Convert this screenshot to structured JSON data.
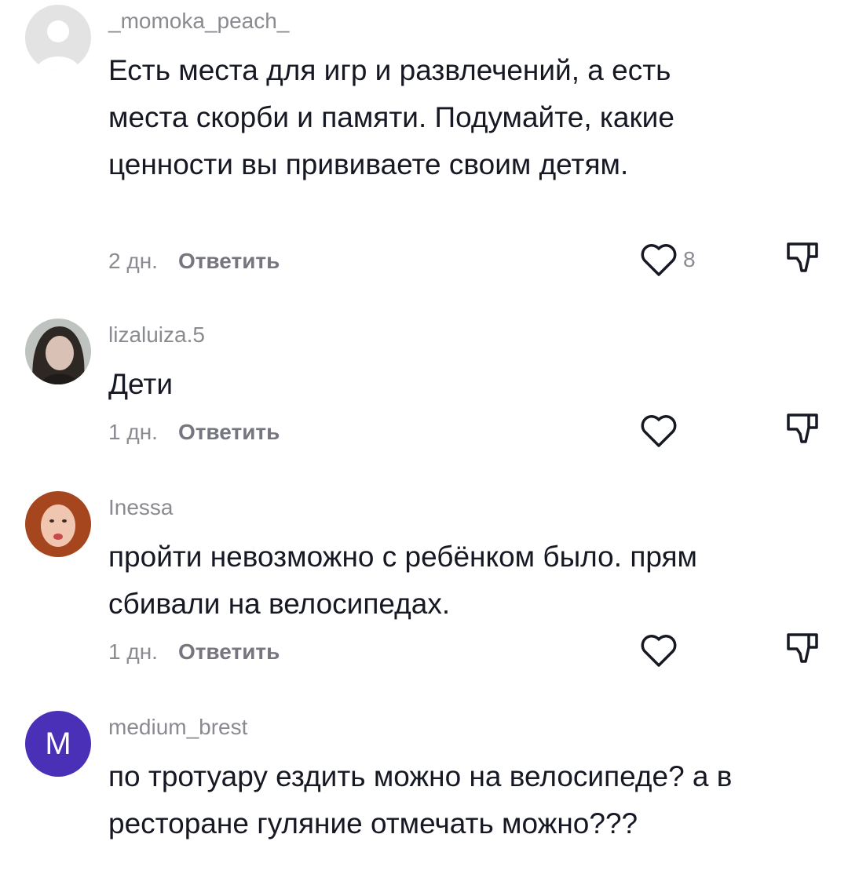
{
  "comments": [
    {
      "username": "_momoka_peach_",
      "text": "Есть места для игр и развлечений, а есть места скорби и памяти. Подумайте, какие ценности вы прививаете своим детям.",
      "time": "2 дн.",
      "reply_label": "Ответить",
      "likes": "8",
      "avatar": "default-avatar-icon"
    },
    {
      "username": "lizaluiza.5",
      "text": "Дети",
      "time": "1 дн.",
      "reply_label": "Ответить",
      "likes": "",
      "avatar": "user-photo"
    },
    {
      "username": "Inessa",
      "text": "пройти невозможно с ребёнком было. прям сбивали на велосипедах.",
      "time": "1 дн.",
      "reply_label": "Ответить",
      "likes": "",
      "avatar": "user-photo"
    },
    {
      "username": "medium_brest",
      "text": "по тротуару ездить можно на велосипеде? а в ресторане гуляние отмечать можно???",
      "avatar_letter": "M",
      "avatar_color": "#4a30b7"
    }
  ],
  "colors": {
    "text": "#161823",
    "secondary": "#8a8b91",
    "icon": "#161823"
  }
}
